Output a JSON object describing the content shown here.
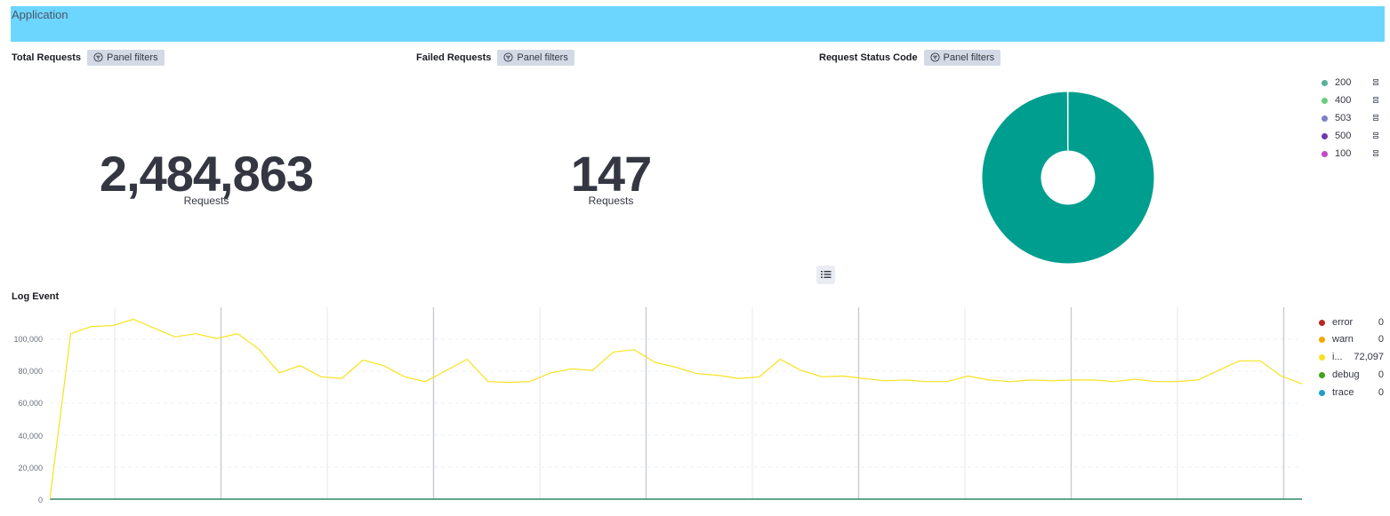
{
  "header": {
    "title": "Application"
  },
  "panels": {
    "total_requests": {
      "title": "Total Requests",
      "filters_label": "Panel filters",
      "value": "2,484,863",
      "unit": "Requests"
    },
    "failed_requests": {
      "title": "Failed Requests",
      "filters_label": "Panel filters",
      "value": "147",
      "unit": "Requests"
    },
    "status_code": {
      "title": "Request Status Code",
      "filters_label": "Panel filters",
      "legend": [
        {
          "label": "200",
          "color": "#54b399"
        },
        {
          "label": "400",
          "color": "#6dcc7e"
        },
        {
          "label": "503",
          "color": "#7b82c4"
        },
        {
          "label": "500",
          "color": "#6e3ba8"
        },
        {
          "label": "100",
          "color": "#c04bc7"
        }
      ]
    }
  },
  "chart_data": [
    {
      "type": "pie",
      "title": "Request Status Code",
      "donut": true,
      "slices": [
        {
          "label": "200",
          "value": 99.9,
          "color": "#009e8f"
        },
        {
          "label": "400",
          "value": 0.05,
          "color": "#6dcc7e"
        },
        {
          "label": "503",
          "value": 0.03,
          "color": "#7b82c4"
        },
        {
          "label": "500",
          "value": 0.01,
          "color": "#6e3ba8"
        },
        {
          "label": "100",
          "value": 0.01,
          "color": "#c04bc7"
        }
      ]
    },
    {
      "type": "line",
      "title": "Log Event",
      "ylim": [
        0,
        120000
      ],
      "yticks": [
        "0",
        "20,000",
        "40,000",
        "60,000",
        "80,000",
        "100,000"
      ],
      "series": [
        {
          "name": "error",
          "color": "#bd271e",
          "value_label": "0",
          "values": []
        },
        {
          "name": "warn",
          "color": "#f5a700",
          "value_label": "0",
          "values": []
        },
        {
          "name": "i...",
          "color": "#f7e21e",
          "value_label": "72,097",
          "values": [
            0,
            103500,
            108000,
            108500,
            112500,
            107000,
            101500,
            103500,
            100500,
            103500,
            94000,
            79000,
            83500,
            76500,
            75500,
            87000,
            83500,
            76500,
            73500,
            80500,
            87500,
            73500,
            73000,
            73500,
            79000,
            81500,
            80500,
            92000,
            93500,
            85500,
            82500,
            78500,
            77500,
            75500,
            76500,
            87500,
            80500,
            76500,
            77000,
            75500,
            74000,
            74500,
            73500,
            73500,
            77000,
            74500,
            73500,
            74500,
            74000,
            74500,
            74500,
            73500,
            75000,
            73500,
            73500,
            74500,
            80500,
            86500,
            86500,
            77000,
            72097
          ]
        },
        {
          "name": "debug",
          "color": "#47a11a",
          "value_label": "0",
          "values": []
        },
        {
          "name": "trace",
          "color": "#1b9ecb",
          "value_label": "0",
          "values": []
        }
      ]
    }
  ],
  "log_event": {
    "title": "Log Event"
  }
}
